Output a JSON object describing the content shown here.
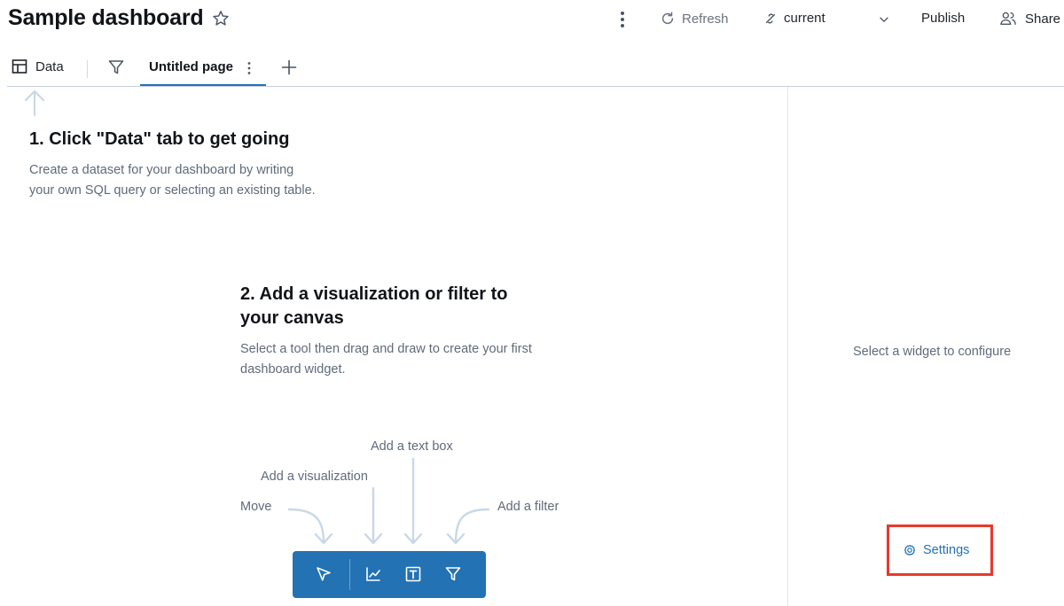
{
  "header": {
    "title": "Sample dashboard",
    "refresh_label": "Refresh",
    "branch_label": "current",
    "publish_label": "Publish",
    "share_label": "Share"
  },
  "tabs": {
    "data_label": "Data",
    "page_label": "Untitled page"
  },
  "canvas": {
    "step1_title": "1. Click \"Data\" tab to get going",
    "step1_desc": "Create a dataset for your dashboard by writing your own SQL query or selecting an existing table.",
    "step2_title": "2. Add a visualization or filter to your canvas",
    "step2_desc": "Select a tool then drag and draw to create your first dashboard widget.",
    "hints": {
      "move": "Move",
      "visualization": "Add a visualization",
      "textbox": "Add a text box",
      "filter": "Add a filter"
    }
  },
  "toolbar": {
    "tools": [
      "pointer-icon",
      "line-chart-icon",
      "text-box-icon",
      "filter-icon"
    ]
  },
  "panel": {
    "empty_text": "Select a widget to configure",
    "settings_label": "Settings"
  },
  "colors": {
    "accent": "#2272b4",
    "highlight": "#e8392c",
    "hint_arrow": "#c9d8e6",
    "muted_text": "#5f6b7a"
  }
}
